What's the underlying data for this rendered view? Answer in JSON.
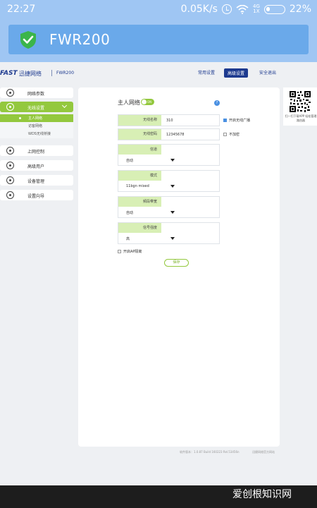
{
  "status_bar": {
    "time": "22:27",
    "net_speed": "0.05K/s",
    "signal_top": "4G",
    "signal_bottom": "1X",
    "battery_percent": "22%",
    "battery_level": 0.22
  },
  "app": {
    "title": "FWR200",
    "shield_icon": "shield-check-icon",
    "colors": {
      "bar": "#9fc6f3",
      "inner": "#6aa9ea",
      "green": "#3bb54a"
    }
  },
  "header": {
    "logo": "FAST",
    "logo_cn": "迅捷网络",
    "model": "FWR200",
    "nav": [
      "常用设置",
      "高级设置",
      "安全退出"
    ],
    "active_nav": "高级设置"
  },
  "sidebar": {
    "items": [
      {
        "label": "网络参数",
        "icon": "globe-icon"
      },
      {
        "label": "无线设置",
        "icon": "wifi-icon",
        "active": true
      },
      {
        "label": "上网控制",
        "icon": "control-icon"
      },
      {
        "label": "高级用户",
        "icon": "user-icon"
      },
      {
        "label": "设备管理",
        "icon": "settings-icon"
      },
      {
        "label": "设置向导",
        "icon": "info-icon"
      }
    ],
    "sub_items": [
      {
        "label": "主人网络",
        "active": true
      },
      {
        "label": "访客网络"
      },
      {
        "label": "WDS无线桥接"
      }
    ]
  },
  "panel": {
    "title": "主人网络",
    "toggle_text": "ON",
    "help": "?",
    "ssid_label": "无线名称",
    "ssid_value": "310",
    "broadcast_label": "开启无线广播",
    "password_label": "无线密码",
    "password_value": "12345678",
    "no_encrypt_label": "不加密",
    "channel_label": "信道",
    "channel_value": "自动",
    "mode_label": "模式",
    "mode_value": "11bgn mixed",
    "bandwidth_label": "频段带宽",
    "bandwidth_value": "自动",
    "signal_label": "信号强度",
    "signal_value": "高",
    "ap_isolation_label": "开启AP隔离",
    "save_label": "保存"
  },
  "qr": {
    "text": "扫一扫下载APP 轻松管理路由器"
  },
  "footer": {
    "version": "软件版本：1.0.87 Build 160223 Rel.53456n",
    "site": "迅捷网络官方网站"
  },
  "watermark": "爱创根知识网"
}
